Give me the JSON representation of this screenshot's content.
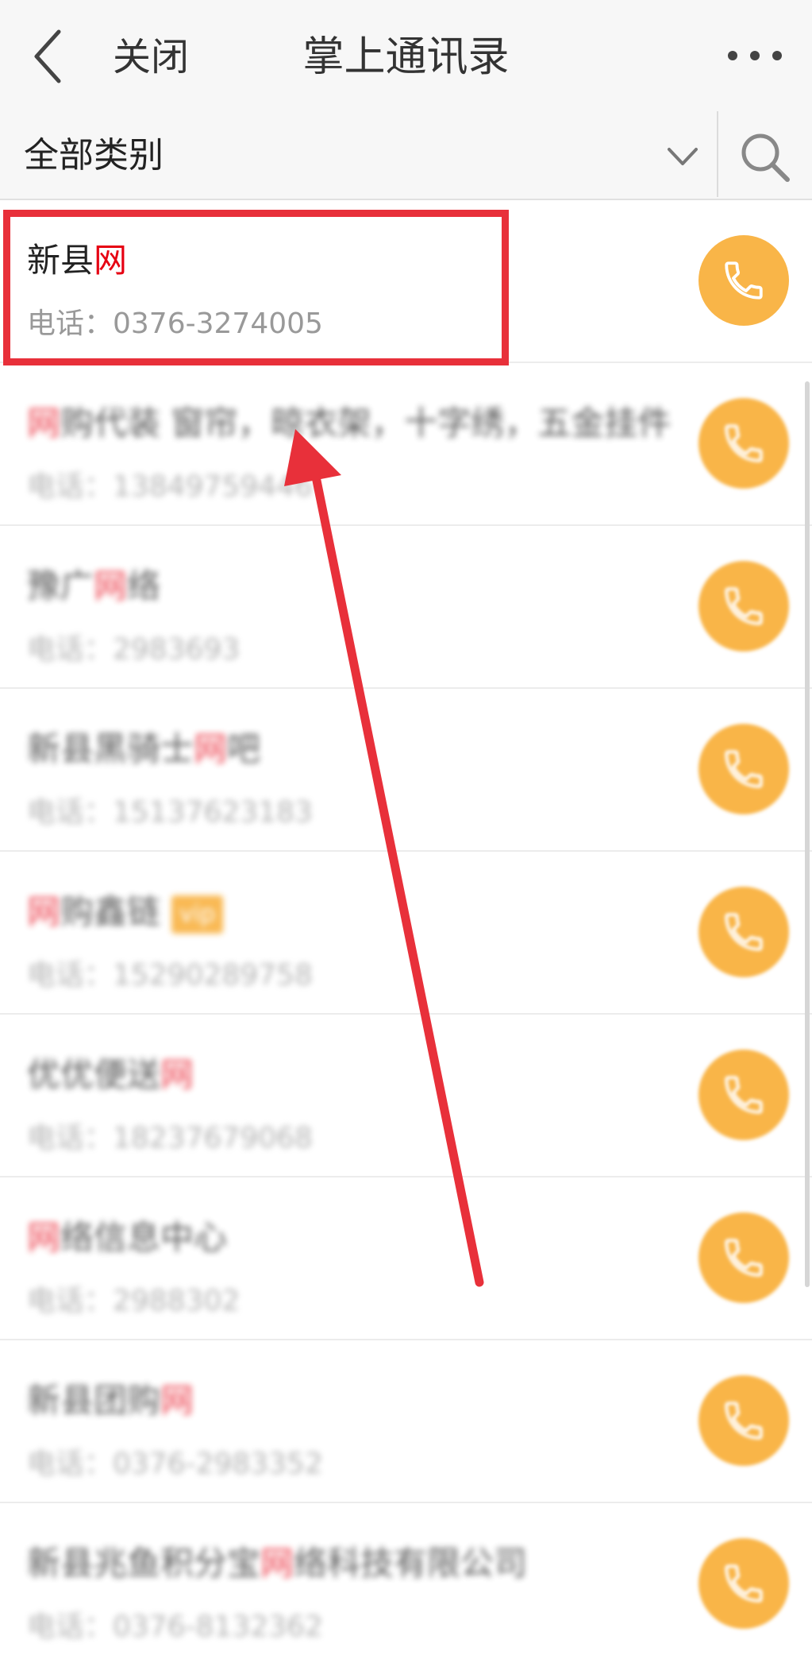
{
  "header": {
    "close_label": "关闭",
    "title": "掌上通讯录"
  },
  "filter": {
    "category": "全部类别"
  },
  "icons": {
    "back": "chevron-left-icon",
    "more": "more-dots-icon",
    "dropdown": "chevron-down-icon",
    "search": "search-icon",
    "call": "phone-icon"
  },
  "colors": {
    "highlight": "#e60012",
    "call_button": "#f9b548",
    "annotation": "#e8303a"
  },
  "contacts": [
    {
      "pre": "新县",
      "hl": "网",
      "post": "",
      "phone": "电话：0376-3274005"
    },
    {
      "pre": "",
      "hl": "网",
      "post": "购代装 窗帘，晾衣架，十字绣，五金挂件",
      "phone": "电话：13849759446"
    },
    {
      "pre": "豫广",
      "hl": "网",
      "post": "络",
      "phone": "电话：2983693"
    },
    {
      "pre": "新县黑骑士",
      "hl": "网",
      "post": "吧",
      "phone": "电话：15137623183"
    },
    {
      "pre": "",
      "hl": "网",
      "post": "购鑫链",
      "badge": "vip",
      "phone": "电话：15290289758"
    },
    {
      "pre": "优优便送",
      "hl": "网",
      "post": "",
      "phone": "电话：18237679068"
    },
    {
      "pre": "",
      "hl": "网",
      "post": "络信息中心",
      "phone": "电话：2988302"
    },
    {
      "pre": "新县团购",
      "hl": "网",
      "post": "",
      "phone": "电话：0376-2983352"
    },
    {
      "pre": "新县兆鱼积分宝",
      "hl": "网",
      "post": "络科技有限公司",
      "phone": "电话：0376-8132362"
    }
  ]
}
